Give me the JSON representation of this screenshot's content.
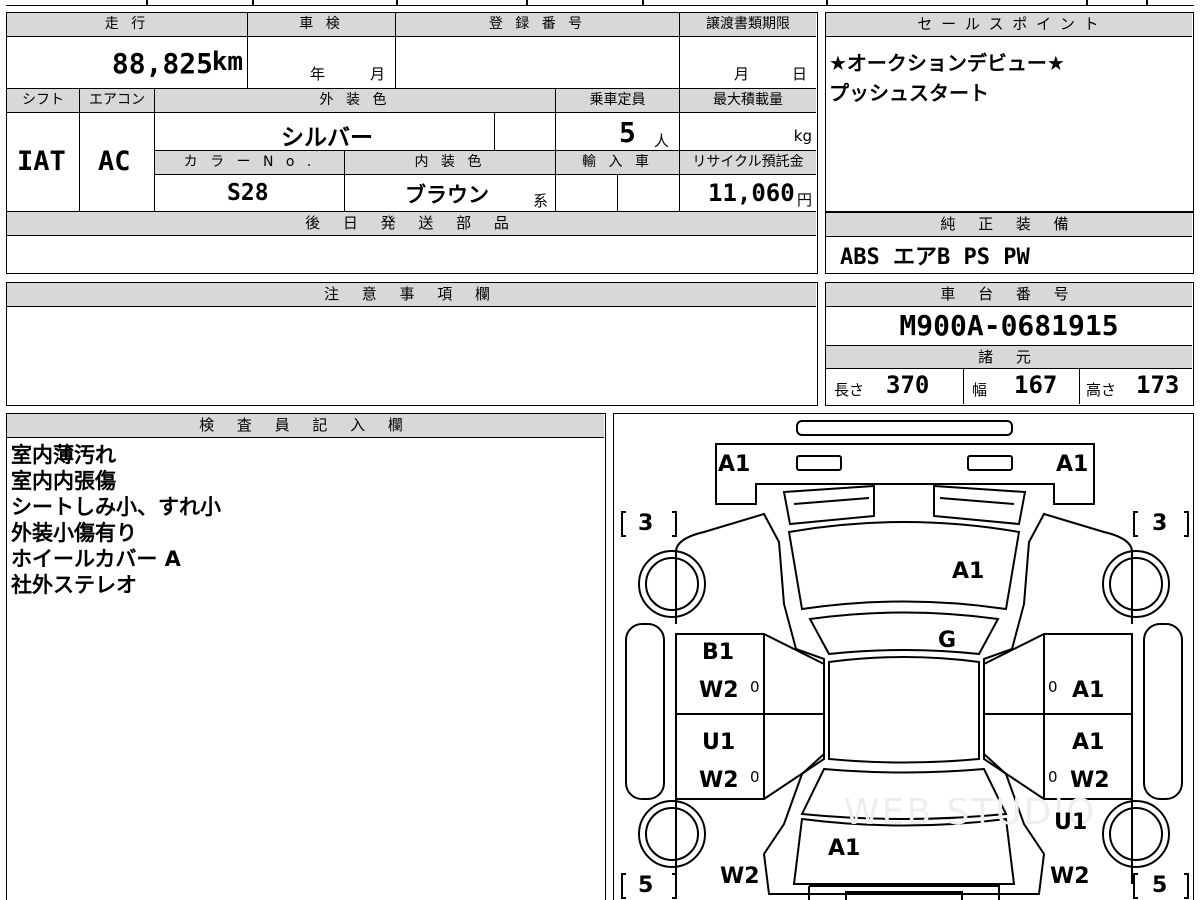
{
  "top_strip": true,
  "labels": {
    "mileage": "走 行",
    "inspection": "車 検",
    "registration": "登 録 番 号",
    "deadline": "譲渡書類期限",
    "sales_points": "セ ー ル ス ポ イ ン ト",
    "shift": "シフト",
    "aircon": "エアコン",
    "exterior_color": "外 装 色",
    "capacity": "乗車定員",
    "max_load": "最大積載量",
    "color_no": "カ ラ ー N o .",
    "interior_color": "内 装 色",
    "import": "輸 入 車",
    "recycle": "リサイクル預託金",
    "later_parts": "後 日 発 送 部 品",
    "standard_equipment": "純 正 装 備",
    "notes": "注 意 事 項 欄",
    "chassis_number": "車 台 番 号",
    "specs": "諸 元",
    "inspector": "検 査 員 記 入 欄",
    "length": "長さ",
    "width": "幅",
    "height": "高さ",
    "year_unit": "年",
    "month_unit": "月",
    "deadline_month": "月",
    "deadline_day": "日",
    "person_unit": "人",
    "kg_unit": "kg",
    "yen_unit": "円",
    "kei_unit": "系"
  },
  "values": {
    "mileage": "88,825",
    "mileage_unit": "km",
    "shift": "IAT",
    "aircon": "AC",
    "exterior_color": "シルバー",
    "capacity": "5",
    "color_no": "S28",
    "interior_color": "ブラウン",
    "recycle_fee": "11,060",
    "standard_equipment": "ABS エアB PS PW",
    "chassis_number": "M900A-0681915",
    "length": "370",
    "width": "167",
    "height": "173"
  },
  "sales_points": [
    "★オークションデビュー★",
    "プッシュスタート"
  ],
  "inspector_notes": [
    "室内薄汚れ",
    "室内内張傷",
    "シートしみ小、すれ小",
    "外装小傷有り",
    "ホイールカバー A",
    "社外ステレオ"
  ],
  "diagram": {
    "marks": {
      "front_left": "A1",
      "front_right": "A1",
      "bonnet": "A1",
      "windshield": "G",
      "fl_door": "B1",
      "fl_door2": "W2",
      "rl_door": "U1",
      "rl_door2": "W2",
      "fr_door": "A1",
      "rr_door": "A1",
      "rr_door2": "W2",
      "rear_right": "U1",
      "rear_center": "A1",
      "rear_left_w": "W2",
      "rear_right_w": "W2",
      "zero_l1": "0",
      "zero_l2": "0",
      "zero_r1": "0",
      "zero_r2": "0"
    },
    "tire_front_left": "3",
    "tire_front_right": "3",
    "tire_rear_left": "5",
    "tire_rear_right": "5",
    "watermark": "WEB STUDIO"
  }
}
